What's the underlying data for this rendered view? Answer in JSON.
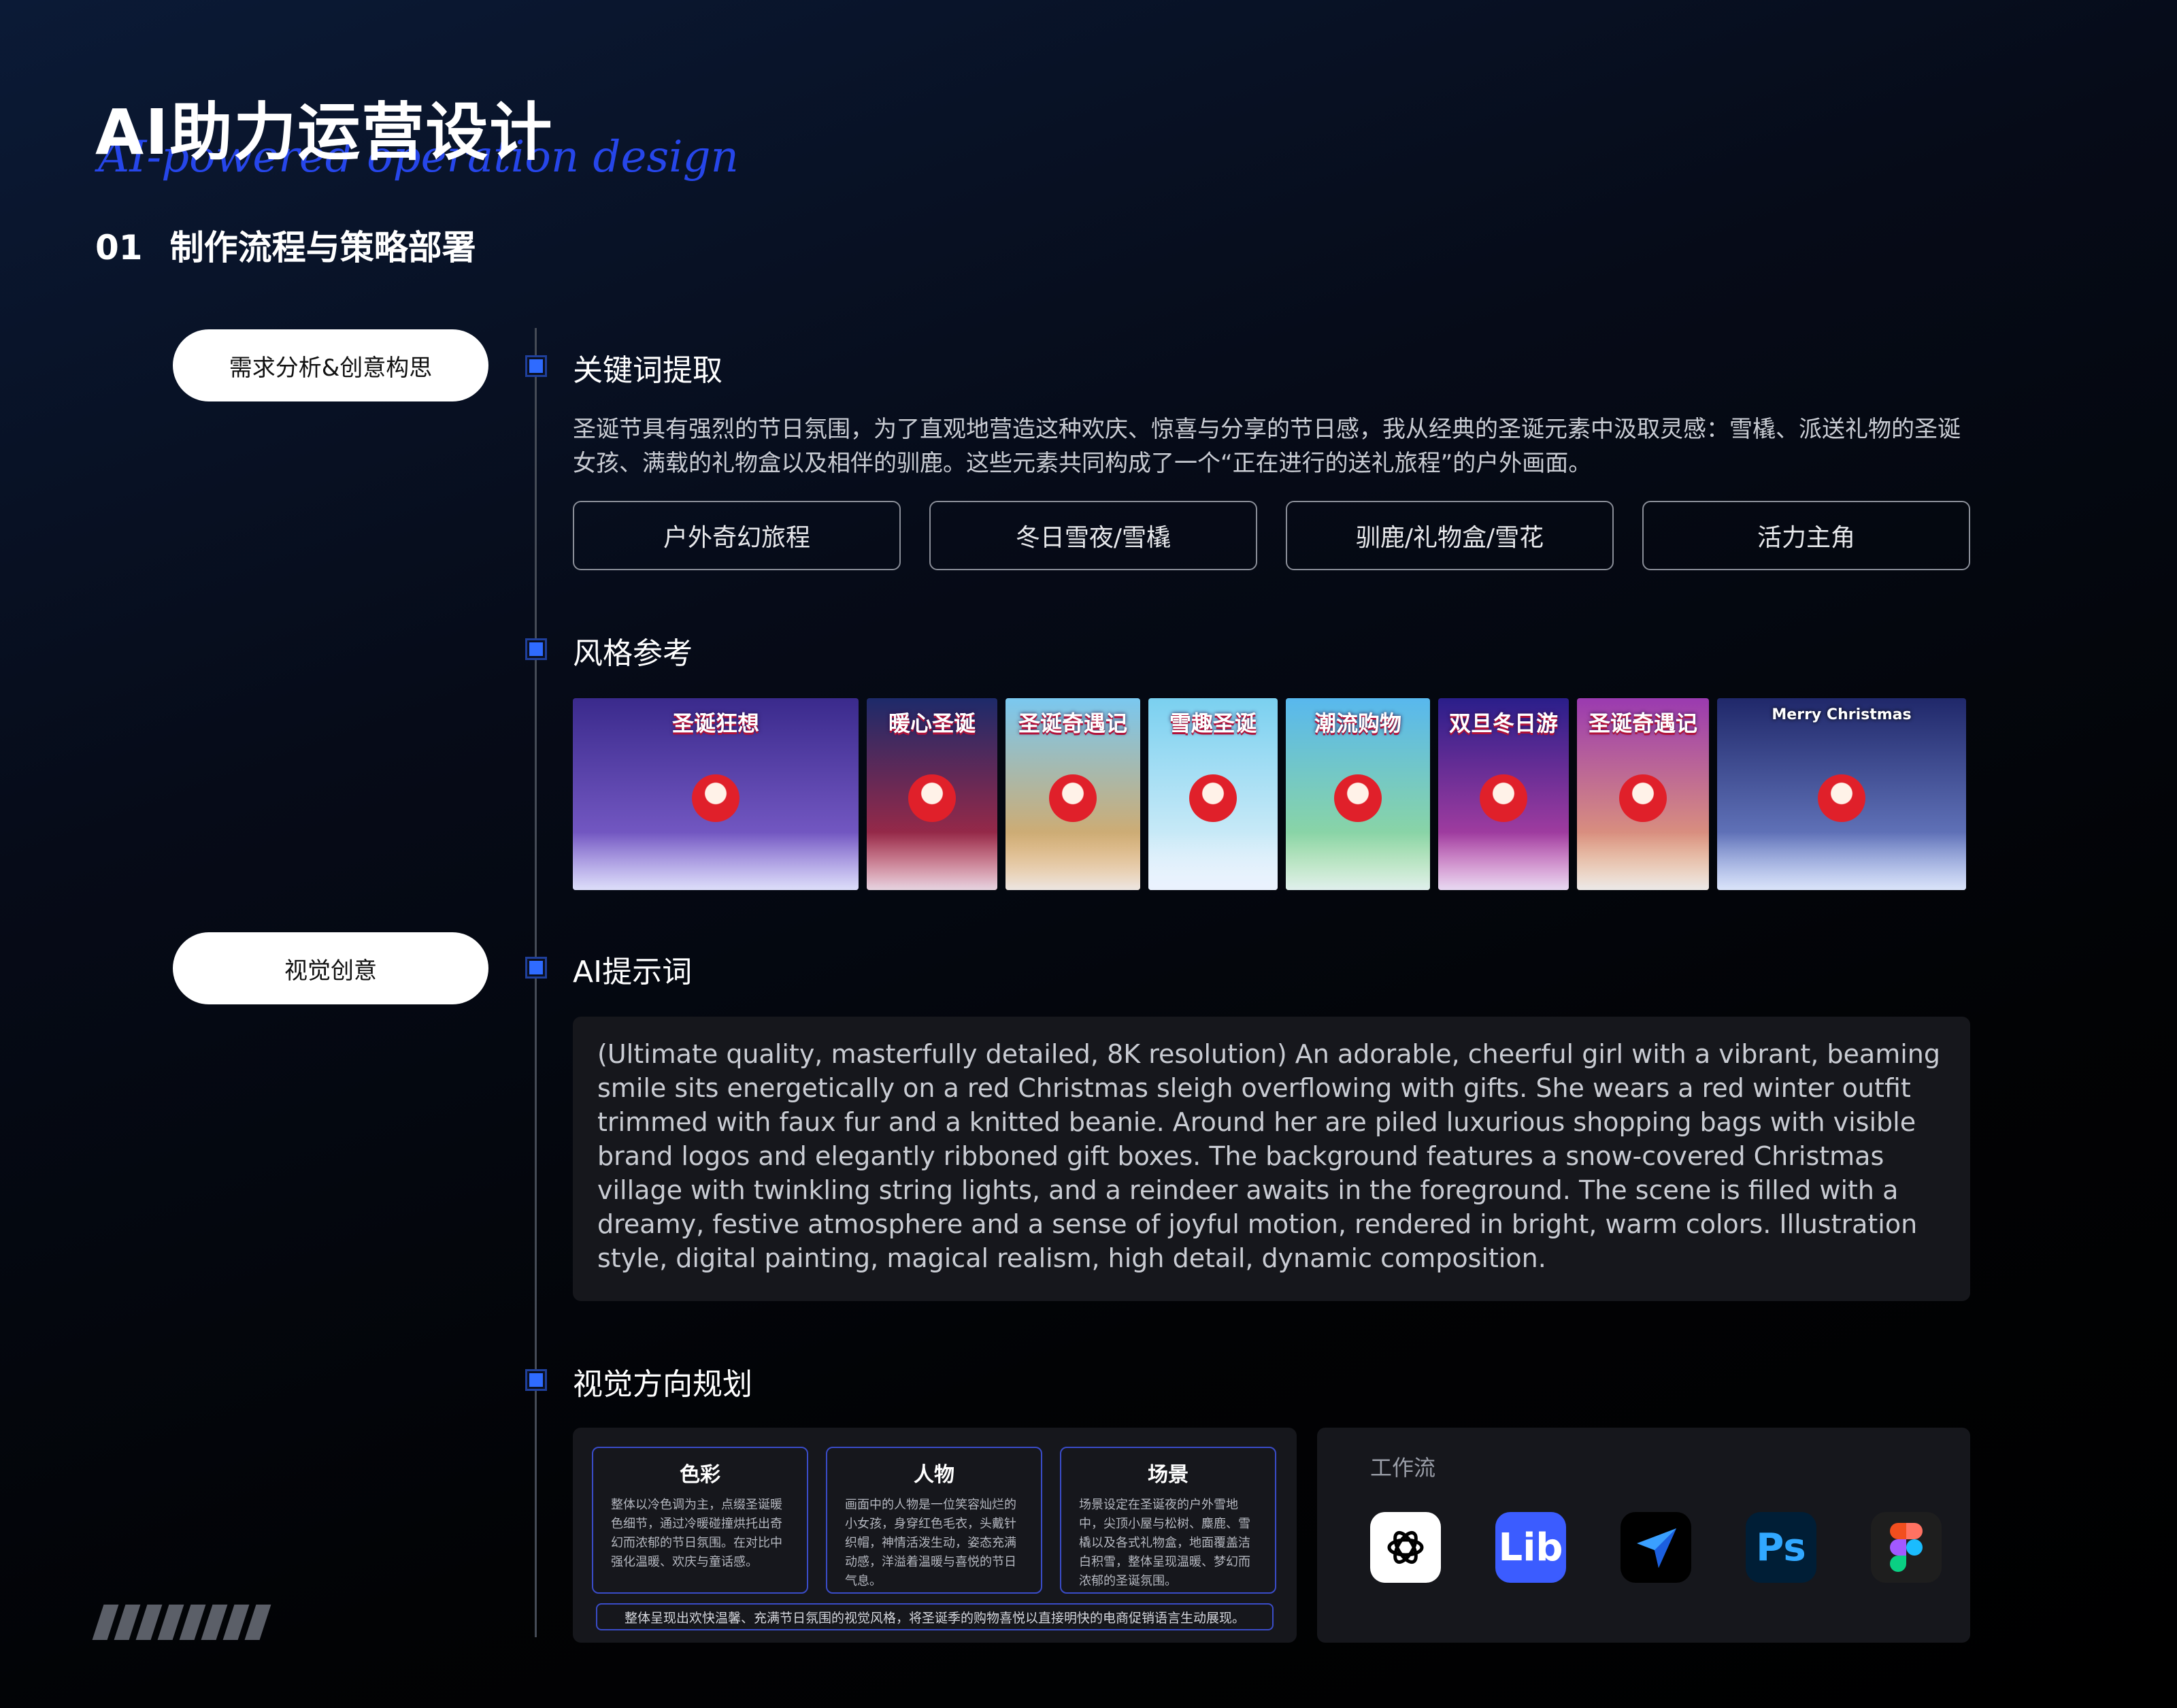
{
  "header": {
    "title": "AI助力运营设计",
    "script_subtitle": "AI-powered operation design",
    "section_number": "01",
    "section_title": "制作流程与策略部署"
  },
  "stages": [
    {
      "label": "需求分析&创意构思"
    },
    {
      "label": "视觉创意"
    }
  ],
  "keywords": {
    "heading": "关键词提取",
    "description": "圣诞节具有强烈的节日氛围，为了直观地营造这种欢庆、惊喜与分享的节日感，我从经典的圣诞元素中汲取灵感：雪橇、派送礼物的圣诞女孩、满载的礼物盒以及相伴的驯鹿。这些元素共同构成了一个“正在进行的送礼旅程”的户外画面。",
    "tags": [
      "户外奇幻旅程",
      "冬日雪夜/雪橇",
      "驯鹿/礼物盒/雪花",
      "活力主角"
    ]
  },
  "style_ref": {
    "heading": "风格参考",
    "images": [
      {
        "caption": "圣诞狂想",
        "color1": "#3a2a8c",
        "color2": "#8a6ad8"
      },
      {
        "caption": "暖心圣诞",
        "color1": "#1d2a6a",
        "color2": "#c8283a"
      },
      {
        "caption": "圣诞奇遇记",
        "color1": "#7ac8f0",
        "color2": "#f0a040"
      },
      {
        "caption": "雪趣圣诞",
        "color1": "#7ad0f0",
        "color2": "#e8f4fa"
      },
      {
        "caption": "潮流购物",
        "color1": "#58b8ee",
        "color2": "#9ee088"
      },
      {
        "caption": "双旦冬日游",
        "color1": "#2a1e8a",
        "color2": "#d048a8"
      },
      {
        "caption": "圣诞奇遇记",
        "color1": "#9a3ab0",
        "color2": "#f3b26a"
      },
      {
        "caption": "Merry Christmas",
        "color1": "#20286a",
        "color2": "#7a90d8"
      }
    ]
  },
  "prompt": {
    "heading": "AI提示词",
    "text": "(Ultimate quality, masterfully detailed, 8K resolution) An adorable, cheerful girl with a vibrant, beaming smile sits energetically on a red Christmas sleigh overflowing with gifts. She wears a red winter outfit trimmed with faux fur and a knitted beanie. Around her are piled luxurious shopping bags with visible brand logos and elegantly ribboned gift boxes. The background features a snow-covered Christmas village with twinkling string lights, and a reindeer awaits in the foreground. The scene is filled with a dreamy, festive atmosphere and a sense of joyful motion, rendered in bright, warm colors. Illustration style, digital painting, magical realism, high detail, dynamic composition."
  },
  "planning": {
    "heading": "视觉方向规划",
    "cards": [
      {
        "title": "色彩",
        "body": "整体以冷色调为主，点缀圣诞暖色细节，通过冷暖碰撞烘托出奇幻而浓郁的节日氛围。在对比中强化温暖、欢庆与童话感。"
      },
      {
        "title": "人物",
        "body": "画面中的人物是一位笑容灿烂的小女孩，身穿红色毛衣，头戴针织帽，神情活泼生动，姿态充满动感，洋溢着温暖与喜悦的节日气息。"
      },
      {
        "title": "场景",
        "body": "场景设定在圣诞夜的户外雪地中，尖顶小屋与松树、麋鹿、雪橇以及各式礼物盒，地面覆盖洁白积雪，整体呈现温暖、梦幻而浓郁的圣诞氛围。"
      }
    ],
    "summary": "整体呈现出欢快温馨、充满节日氛围的视觉风格，将圣诞季的购物喜悦以直接明快的电商促销语言生动展现。"
  },
  "workflow": {
    "title": "工作流",
    "apps": [
      {
        "name": "chatgpt-icon",
        "label": "",
        "bg": "#ffffff",
        "fg": "#000000"
      },
      {
        "name": "liblib-icon",
        "label": "Lib",
        "bg": "#3b5cff",
        "fg": "#ffffff"
      },
      {
        "name": "jimeng-icon",
        "label": "",
        "bg": "#000000",
        "fg": "#3aa0ff"
      },
      {
        "name": "photoshop-icon",
        "label": "Ps",
        "bg": "#001e36",
        "fg": "#31a8ff"
      },
      {
        "name": "figma-icon",
        "label": "",
        "bg": "#1e1e1e",
        "fg": "#ffffff"
      }
    ]
  }
}
